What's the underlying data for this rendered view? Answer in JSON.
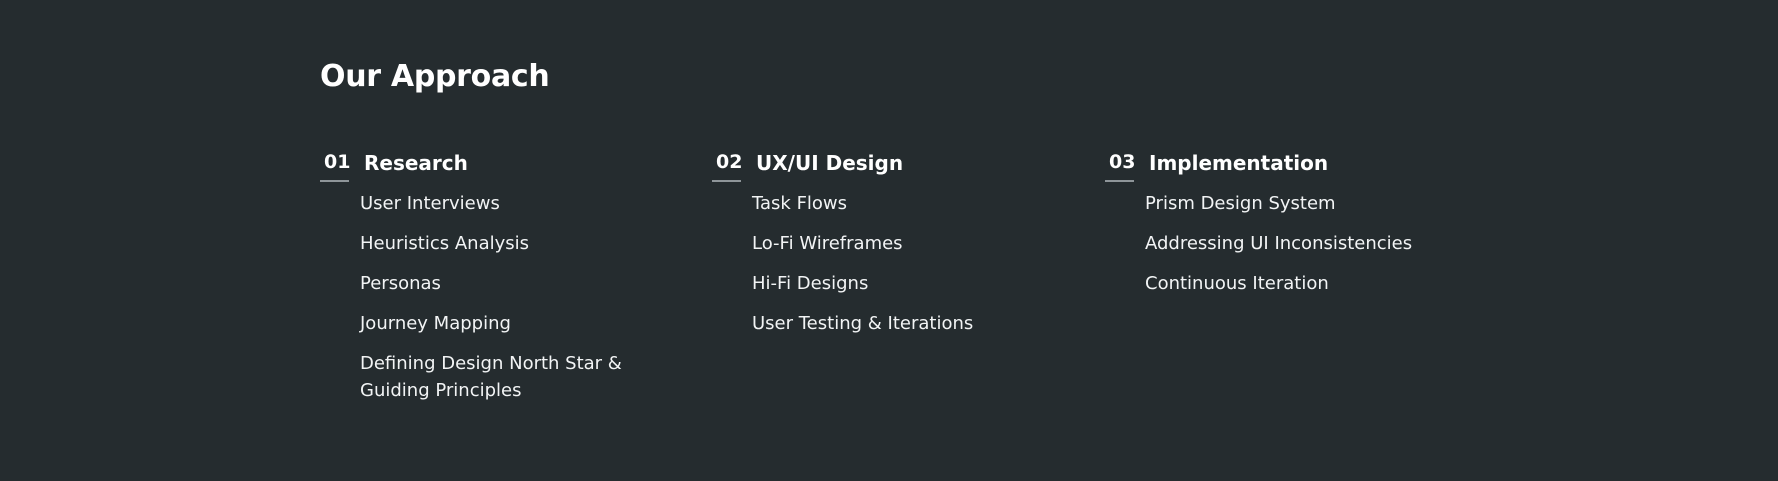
{
  "section": {
    "title": "Our Approach"
  },
  "columns": [
    {
      "number": "01",
      "title": "Research",
      "items": [
        "User Interviews",
        "Heuristics Analysis",
        "Personas",
        "Journey Mapping",
        "Defining Design North Star & Guiding Principles"
      ]
    },
    {
      "number": "02",
      "title": "UX/UI Design",
      "items": [
        "Task Flows",
        "Lo-Fi Wireframes",
        "Hi-Fi Designs",
        "User Testing & Iterations"
      ]
    },
    {
      "number": "03",
      "title": "Implementation",
      "items": [
        "Prism Design System",
        "Addressing UI Inconsistencies",
        "Continuous Iteration"
      ]
    }
  ],
  "colors": {
    "background": "#252c2f",
    "text": "#ffffff",
    "underline": "#8e9599"
  }
}
